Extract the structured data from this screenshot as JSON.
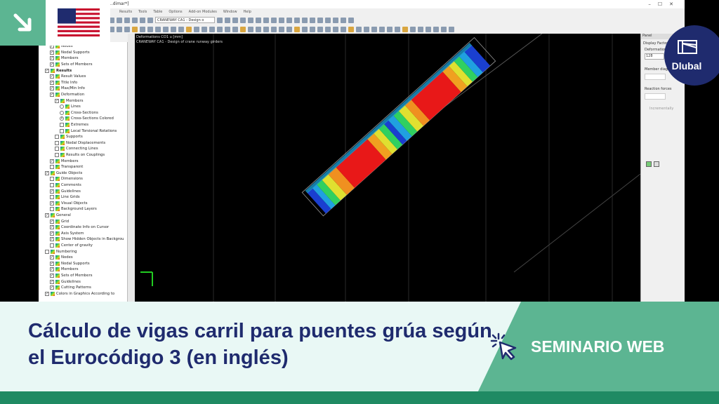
{
  "window": {
    "title": "...dimar*]"
  },
  "menu": [
    "Results",
    "Tools",
    "Table",
    "Options",
    "Add-on Modules",
    "Window",
    "Help"
  ],
  "toolbar": {
    "loadcase_combo": "CRANEWAY CA1 - Design o"
  },
  "navigator": {
    "items": [
      {
        "label": "Nodes",
        "indent": 2,
        "checked": true
      },
      {
        "label": "Nodal Supports",
        "indent": 2,
        "checked": true
      },
      {
        "label": "Members",
        "indent": 2,
        "checked": true
      },
      {
        "label": "Sets of Members",
        "indent": 2,
        "checked": true
      },
      {
        "label": "Results",
        "indent": 1,
        "checked": true,
        "bold": true
      },
      {
        "label": "Result Values",
        "indent": 2,
        "checked": true
      },
      {
        "label": "Title Info",
        "indent": 2,
        "checked": true
      },
      {
        "label": "Max/Min Info",
        "indent": 2,
        "checked": true
      },
      {
        "label": "Deformation",
        "indent": 2,
        "checked": true
      },
      {
        "label": "Members",
        "indent": 3,
        "checked": true
      },
      {
        "label": "Lines",
        "indent": 4,
        "radio": true
      },
      {
        "label": "Cross-Sections",
        "indent": 4,
        "radio": true
      },
      {
        "label": "Cross-Sections Colored",
        "indent": 4,
        "radio": true,
        "selected": true
      },
      {
        "label": "Extremes",
        "indent": 4,
        "checked": false
      },
      {
        "label": "Local Torsional Rotations",
        "indent": 4,
        "checked": false
      },
      {
        "label": "Supports",
        "indent": 3,
        "checked": false
      },
      {
        "label": "Nodal Displacements",
        "indent": 3,
        "checked": false
      },
      {
        "label": "Connecting Lines",
        "indent": 3,
        "checked": false
      },
      {
        "label": "Results on Couplings",
        "indent": 3,
        "checked": false
      },
      {
        "label": "Members",
        "indent": 2,
        "checked": true
      },
      {
        "label": "Transparent",
        "indent": 2,
        "checked": false
      },
      {
        "label": "Guide Objects",
        "indent": 1,
        "checked": true
      },
      {
        "label": "Dimensions",
        "indent": 2,
        "checked": false
      },
      {
        "label": "Comments",
        "indent": 2,
        "checked": false
      },
      {
        "label": "Guidelines",
        "indent": 2,
        "checked": true
      },
      {
        "label": "Line Grids",
        "indent": 2,
        "checked": false
      },
      {
        "label": "Visual Objects",
        "indent": 2,
        "checked": true
      },
      {
        "label": "Background Layers",
        "indent": 2,
        "checked": false
      },
      {
        "label": "General",
        "indent": 1,
        "checked": true
      },
      {
        "label": "Grid",
        "indent": 2,
        "checked": true
      },
      {
        "label": "Coordinate Info on Cursor",
        "indent": 2,
        "checked": true
      },
      {
        "label": "Axis System",
        "indent": 2,
        "checked": true
      },
      {
        "label": "Show Hidden Objects in Backgrou",
        "indent": 2,
        "checked": true
      },
      {
        "label": "Center of gravity",
        "indent": 2,
        "checked": false
      },
      {
        "label": "Numbering",
        "indent": 1,
        "checked": false
      },
      {
        "label": "Nodes",
        "indent": 2,
        "checked": true
      },
      {
        "label": "Nodal Supports",
        "indent": 2,
        "checked": true
      },
      {
        "label": "Members",
        "indent": 2,
        "checked": true
      },
      {
        "label": "Sets of Members",
        "indent": 2,
        "checked": true
      },
      {
        "label": "Guidelines",
        "indent": 2,
        "checked": true
      },
      {
        "label": "Cutting Patterns",
        "indent": 2,
        "checked": true
      },
      {
        "label": "Colors in Graphics According to",
        "indent": 1,
        "checked": true
      }
    ]
  },
  "viewport": {
    "line1": "Deformations CO1 u [mm]",
    "line2": "CRANEWAY CA1 - Design of crane runway girders"
  },
  "panel": {
    "title": "Panel",
    "display_factors": "Display Factors",
    "deformation_label": "Deformation",
    "deformation_value": "128",
    "member_diagrams": "Member diagra",
    "reaction_forces": "Reaction forces",
    "incrementally": "Incrementally"
  },
  "brand": {
    "logo_text": "Dlubal"
  },
  "banner": {
    "headline": "Cálculo de vigas carril para puentes grúa según el Eurocódigo 3 (en inglés)",
    "tag": "SEMINARIO WEB"
  },
  "colors": {
    "brand_navy": "#1f2b6e",
    "brand_green": "#5cb592",
    "dark_green": "#1f8a63"
  }
}
